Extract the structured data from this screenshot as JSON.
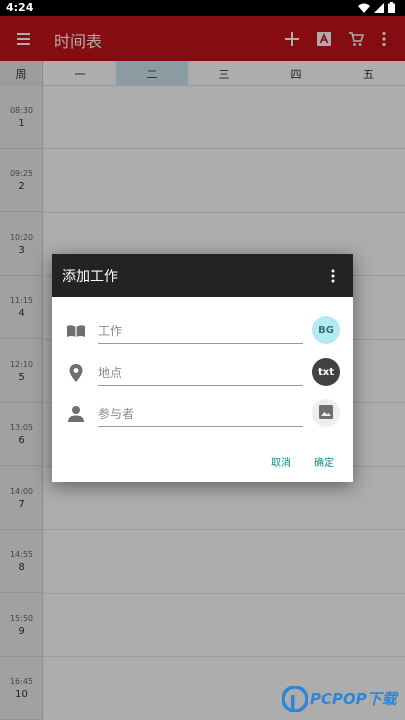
{
  "status": {
    "time": "4:24"
  },
  "appbar": {
    "title": "时间表",
    "accent": "#c4121a"
  },
  "week": {
    "corner": "周",
    "days": [
      "一",
      "二",
      "三",
      "四",
      "五"
    ],
    "selected_day": "二"
  },
  "slots": [
    {
      "time": "08:30",
      "num": "1"
    },
    {
      "time": "09:25",
      "num": "2"
    },
    {
      "time": "10:20",
      "num": "3"
    },
    {
      "time": "11:15",
      "num": "4"
    },
    {
      "time": "12:10",
      "num": "5"
    },
    {
      "time": "13:05",
      "num": "6"
    },
    {
      "time": "14:00",
      "num": "7"
    },
    {
      "time": "14:55",
      "num": "8"
    },
    {
      "time": "15:50",
      "num": "9"
    },
    {
      "time": "16:45",
      "num": "10"
    }
  ],
  "dialog": {
    "title": "添加工作",
    "fields": {
      "job": {
        "placeholder": "工作",
        "value": "",
        "button": "BG",
        "button_color": "#b2ebf2"
      },
      "location": {
        "placeholder": "地点",
        "value": "",
        "button": "txt",
        "button_color": "#424242"
      },
      "participants": {
        "placeholder": "参与者",
        "value": "",
        "button_color": "#eeeeee"
      }
    },
    "cancel": "取消",
    "confirm": "确定"
  },
  "watermark": {
    "text": "PCPOP下载"
  }
}
